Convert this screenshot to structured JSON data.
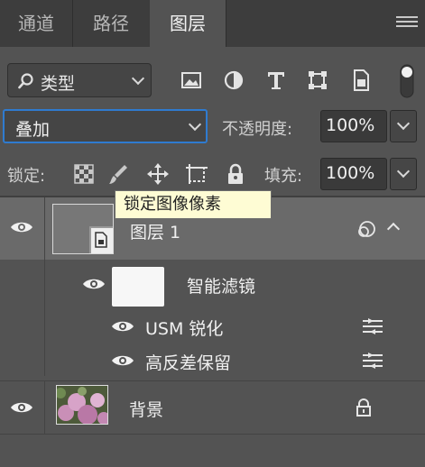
{
  "tabs": [
    {
      "label": "通道",
      "active": false
    },
    {
      "label": "路径",
      "active": false
    },
    {
      "label": "图层",
      "active": true
    }
  ],
  "filter": {
    "label": "类型",
    "icons": [
      "image-filter-icon",
      "adjustment-filter-icon",
      "type-filter-icon",
      "shape-filter-icon",
      "smart-object-filter-icon",
      "filter-toggle-icon"
    ]
  },
  "blend": {
    "mode": "叠加",
    "opacity_label": "不透明度:",
    "opacity_value": "100%"
  },
  "lock": {
    "label": "锁定:",
    "fill_label": "填充:",
    "fill_value": "100%",
    "icons": [
      "lock-transparent-pixels-icon",
      "lock-image-pixels-icon",
      "lock-position-icon",
      "lock-artboard-icon",
      "lock-all-icon"
    ]
  },
  "tooltip": "锁定图像像素",
  "layers": [
    {
      "name": "图层 1",
      "selected": true
    },
    {
      "name": "背景",
      "selected": false
    }
  ],
  "smart_filters": {
    "label": "智能滤镜",
    "items": [
      {
        "name": "USM 锐化"
      },
      {
        "name": "高反差保留"
      }
    ]
  },
  "colors": {
    "panel_bg": "#535353",
    "tabbar_bg": "#3d3d3d",
    "selected_row": "#6a6a6a",
    "focus_blue": "#2f7bd0",
    "tooltip_bg": "#fefcd4"
  }
}
